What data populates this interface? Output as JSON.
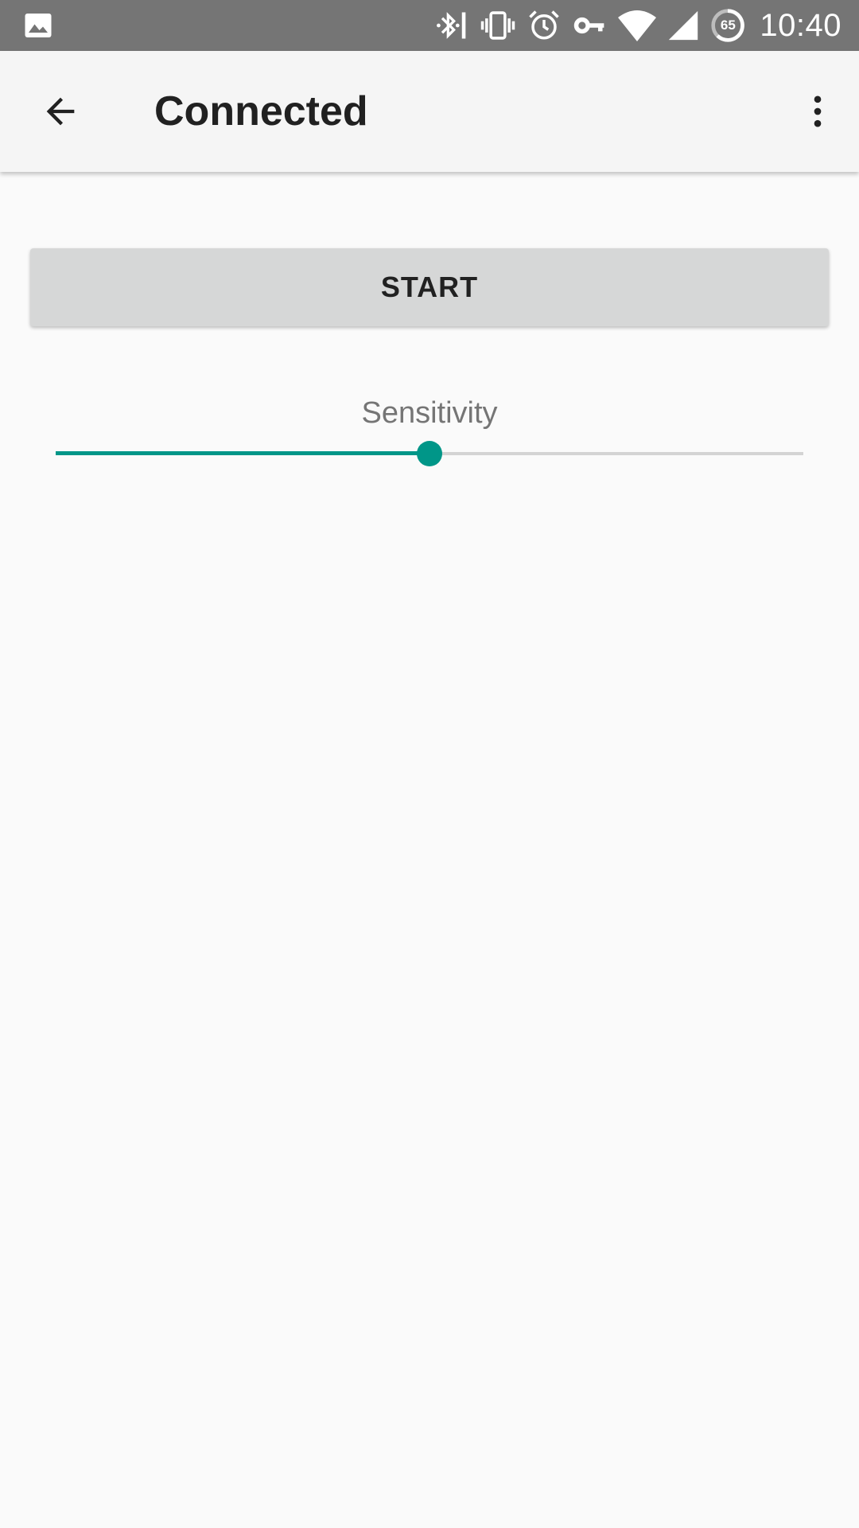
{
  "status_bar": {
    "time": "10:40",
    "battery_level": "65",
    "icons": [
      "image-icon",
      "bluetooth-icon",
      "vibrate-icon",
      "alarm-icon",
      "vpn-key-icon",
      "wifi-icon",
      "cell-signal-icon",
      "battery-icon"
    ]
  },
  "app_bar": {
    "title": "Connected",
    "back_icon": "arrow-back-icon",
    "overflow_icon": "more-vert-icon"
  },
  "main": {
    "start_label": "START",
    "sensitivity": {
      "label": "Sensitivity",
      "value_fraction": 0.5
    }
  },
  "colors": {
    "status_bar": "#757575",
    "app_bar": "#f5f5f5",
    "background": "#fafafa",
    "accent": "#009688",
    "button": "#d6d7d7",
    "track": "#d3d3d3"
  }
}
